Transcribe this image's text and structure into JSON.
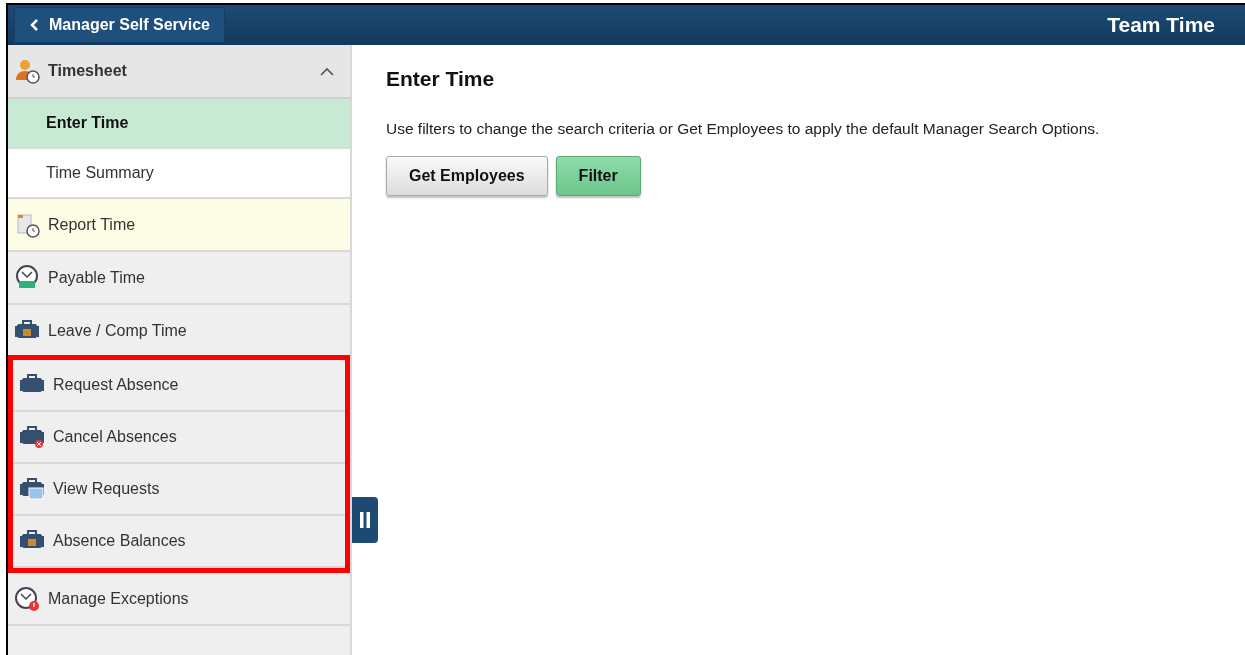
{
  "header": {
    "back_label": "Manager Self Service",
    "title": "Team Time"
  },
  "sidebar": {
    "items": [
      {
        "kind": "group",
        "label": "Timesheet",
        "expanded": true,
        "children": [
          {
            "label": "Enter Time",
            "selected": true
          },
          {
            "label": "Time Summary",
            "selected": false
          }
        ]
      },
      {
        "kind": "link",
        "label": "Report Time",
        "selected": false,
        "hovered": true,
        "highlighted": false
      },
      {
        "kind": "link",
        "label": "Payable Time",
        "selected": false,
        "hovered": false,
        "highlighted": false
      },
      {
        "kind": "link",
        "label": "Leave / Comp Time",
        "selected": false,
        "hovered": false,
        "highlighted": false
      },
      {
        "kind": "link",
        "label": "Request Absence",
        "selected": false,
        "hovered": false,
        "highlighted": true
      },
      {
        "kind": "link",
        "label": "Cancel Absences",
        "selected": false,
        "hovered": false,
        "highlighted": true
      },
      {
        "kind": "link",
        "label": "View Requests",
        "selected": false,
        "hovered": false,
        "highlighted": true
      },
      {
        "kind": "link",
        "label": "Absence Balances",
        "selected": false,
        "hovered": false,
        "highlighted": true
      },
      {
        "kind": "link",
        "label": "Manage Exceptions",
        "selected": false,
        "hovered": false,
        "highlighted": false
      }
    ]
  },
  "content": {
    "title": "Enter Time",
    "instructions": "Use filters to change the search criteria or Get Employees to apply the default Manager Search Options.",
    "buttons": [
      {
        "label": "Get Employees",
        "kind": "default"
      },
      {
        "label": "Filter",
        "kind": "primary"
      }
    ]
  }
}
